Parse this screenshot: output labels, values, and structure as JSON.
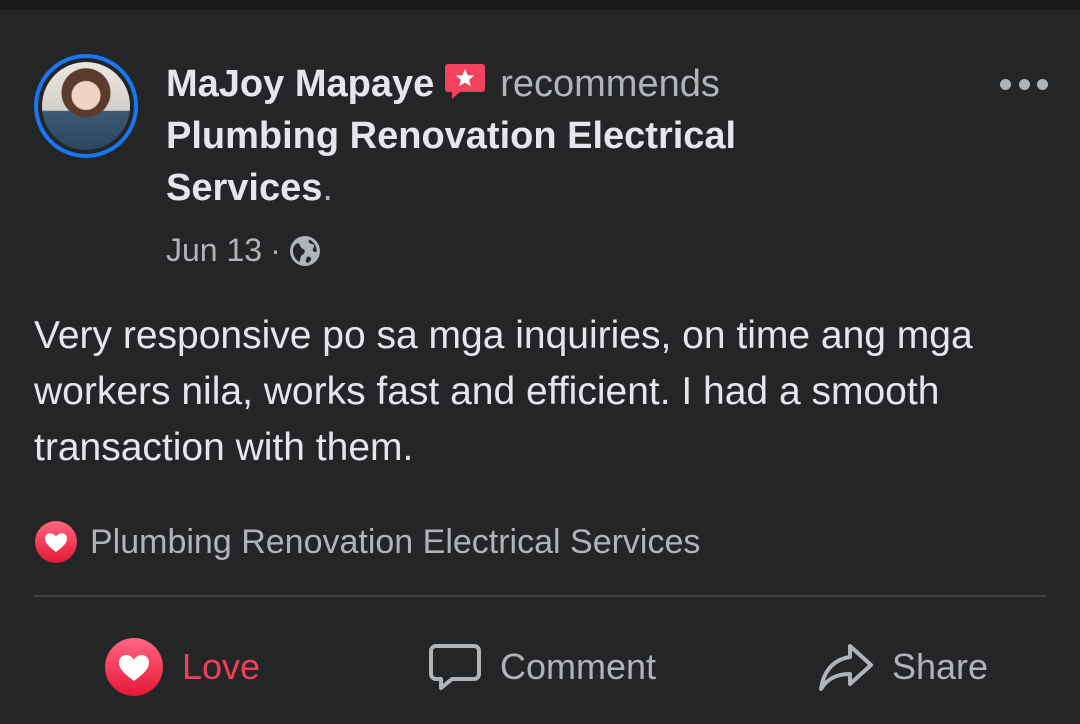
{
  "post": {
    "author": "MaJoy Mapaye",
    "action_text": "recommends",
    "page_name": "Plumbing Renovation Electrical Services",
    "period": ".",
    "date": "Jun 13",
    "separator": "·",
    "privacy_icon": "globe-icon",
    "body": "Very responsive po sa mga inquiries, on time ang mga workers nila, works fast and efficient. I had a smooth transaction with them.",
    "tag_label": "Plumbing Renovation Electrical Services"
  },
  "actions": {
    "love_label": "Love",
    "comment_label": "Comment",
    "share_label": "Share"
  },
  "colors": {
    "background": "#242526",
    "accent_blue": "#1877f2",
    "love_red": "#f33e58",
    "text_primary": "#e4e6eb",
    "text_secondary": "#b0b3b8"
  }
}
